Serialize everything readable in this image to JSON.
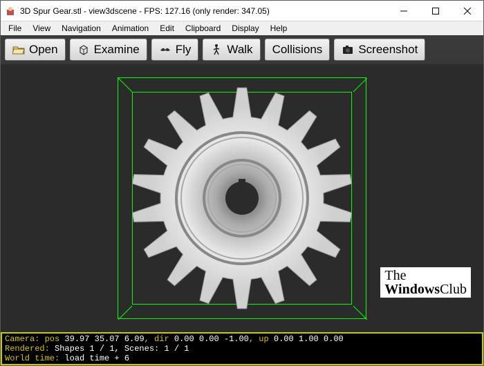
{
  "titlebar": {
    "title": "3D Spur Gear.stl - view3dscene - FPS: 127.16 (only render: 347.05)"
  },
  "menu": {
    "items": [
      "File",
      "View",
      "Navigation",
      "Animation",
      "Edit",
      "Clipboard",
      "Display",
      "Help"
    ]
  },
  "toolbar": {
    "open": "Open",
    "examine": "Examine",
    "fly": "Fly",
    "walk": "Walk",
    "collisions": "Collisions",
    "screenshot": "Screenshot"
  },
  "watermark": {
    "line1": "The",
    "line2_a": "Windows",
    "line2_b": "Club"
  },
  "console": {
    "camera_label": "Camera: pos ",
    "camera_pos": "39.97 35.07 6.09",
    "camera_dir_label": ", dir ",
    "camera_dir": "0.00 0.00 -1.00",
    "camera_up_label": ", up ",
    "camera_up": "0.00 1.00 0.00",
    "rendered_label": "Rendered:",
    "rendered_value": " Shapes 1 / 1, Scenes: 1 / 1",
    "world_label": "World time:",
    "world_value": " load time + 6"
  }
}
